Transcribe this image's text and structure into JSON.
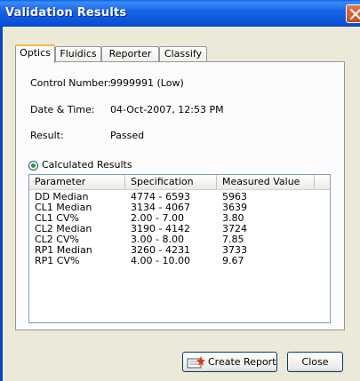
{
  "window": {
    "title": "Validation Results"
  },
  "tabs": [
    {
      "label": "Optics",
      "active": true
    },
    {
      "label": "Fluidics",
      "active": false
    },
    {
      "label": "Reporter",
      "active": false
    },
    {
      "label": "Classify",
      "active": false
    }
  ],
  "info": {
    "control_number_label": "Control Number:",
    "control_number_value": "9999991 (Low)",
    "datetime_label": "Date & Time:",
    "datetime_value": "04-Oct-2007, 12:53 PM",
    "result_label": "Result:",
    "result_value": "Passed"
  },
  "radio": {
    "label": "Calculated Results",
    "checked": true
  },
  "table": {
    "columns": [
      "Parameter",
      "Specification",
      "Measured Value"
    ],
    "rows": [
      [
        "DD Median",
        "4774 - 6593",
        "5963"
      ],
      [
        "CL1 Median",
        "3134 - 4067",
        "3639"
      ],
      [
        "CL1 CV%",
        "2.00 - 7.00",
        "3.80"
      ],
      [
        "CL2 Median",
        "3190 - 4142",
        "3724"
      ],
      [
        "CL2 CV%",
        "3.00 - 8.00",
        "7.85"
      ],
      [
        "RP1 Median",
        "3260 - 4231",
        "3733"
      ],
      [
        "RP1 CV%",
        "4.00 - 10.00",
        "9.67"
      ]
    ]
  },
  "buttons": {
    "create_report": "Create Report",
    "close": "Close"
  },
  "colors": {
    "titlebar": "#0a5fe8",
    "tab_highlight": "#f9b73e",
    "radio_dot": "#21a121",
    "window_bg": "#ece9d8"
  }
}
